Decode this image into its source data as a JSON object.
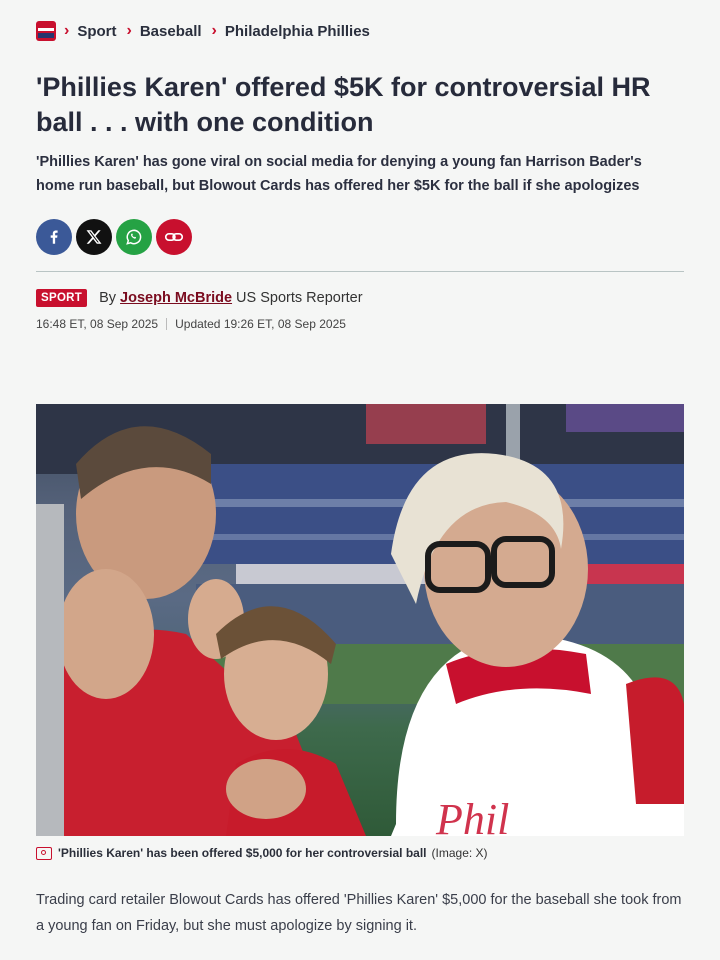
{
  "breadcrumb": {
    "items": [
      "Sport",
      "Baseball",
      "Philadelphia Phillies"
    ]
  },
  "article": {
    "headline": "'Phillies Karen' offered $5K for controversial HR ball . . . with one condition",
    "standfirst": "'Phillies Karen' has gone viral on social media for denying a young fan Harrison Bader's home run baseball, but Blowout Cards has offered her $5K for the ball if she apologizes",
    "section_tag": "SPORT",
    "by_label": "By",
    "author": "Joseph McBride",
    "author_role": "US Sports Reporter",
    "published": "16:48 ET, 08 Sep 2025",
    "updated": "Updated 19:26 ET, 08 Sep 2025",
    "image_caption": "'Phillies Karen' has been offered $5,000 for her controversial ball",
    "image_credit": "(Image: X)",
    "first_paragraph": "Trading card retailer Blowout Cards has offered 'Phillies Karen' $5,000 for the baseball she took from a young fan on Friday, but she must apologize by signing it."
  },
  "share": {
    "buttons": [
      "facebook-icon",
      "x-icon",
      "whatsapp-icon",
      "link-icon"
    ]
  },
  "colors": {
    "accent": "#c8102e",
    "facebook": "#3b5998",
    "x": "#111111",
    "whatsapp": "#25a244",
    "author": "#7a0c1f"
  }
}
